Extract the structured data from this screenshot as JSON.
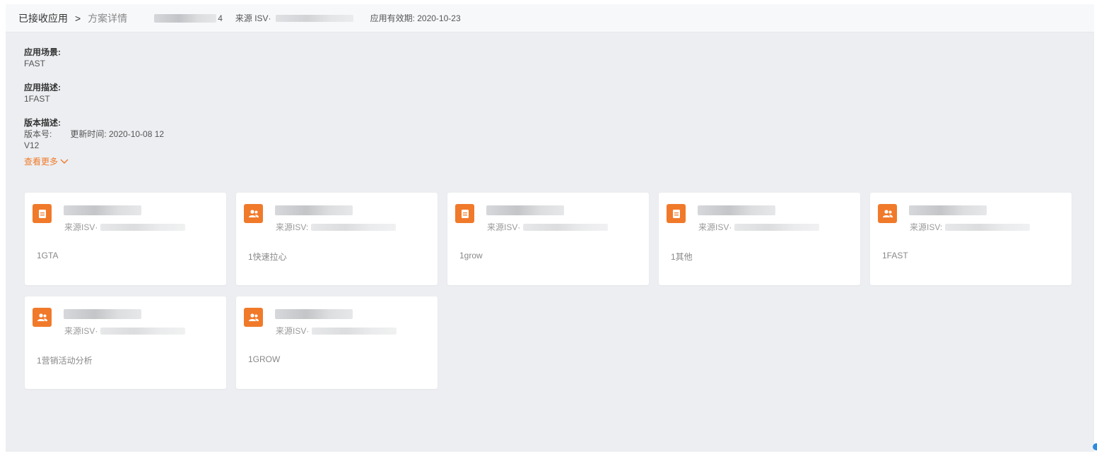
{
  "breadcrumb": {
    "root": "已接收应用",
    "separator": ">",
    "current": "方案详情"
  },
  "header_info": {
    "name_suffix": "4",
    "source_label": "来源 ISV·",
    "validity": "应用有效期: 2020-10-23"
  },
  "details": {
    "scene_label": "应用场景:",
    "scene_value": "FAST",
    "desc_label": "应用描述:",
    "desc_value": "1FAST",
    "version_label": "版本描述:",
    "version_no_label": "版本号:",
    "update_time": "更新时间: 2020-10-08    12",
    "version_value": "V12",
    "more_link": "查看更多"
  },
  "cards": [
    {
      "icon": "doc-icon",
      "source": "来源ISV·",
      "desc": "1GTA"
    },
    {
      "icon": "users-icon",
      "source": "来源ISV:",
      "desc": "1快速拉心"
    },
    {
      "icon": "doc-icon",
      "source": "来源ISV·",
      "desc": "1grow"
    },
    {
      "icon": "doc-icon",
      "source": "来源ISV·",
      "desc": "1其他"
    },
    {
      "icon": "users-icon",
      "source": "来源ISV:",
      "desc": "1FAST"
    },
    {
      "icon": "users-icon",
      "source": "来源ISV·",
      "desc": "1营销活动分析"
    },
    {
      "icon": "users-icon",
      "source": "来源ISV·",
      "desc": "1GROW"
    }
  ],
  "colors": {
    "accent": "#f07a2a",
    "background": "#eceef1",
    "card": "#ffffff"
  }
}
